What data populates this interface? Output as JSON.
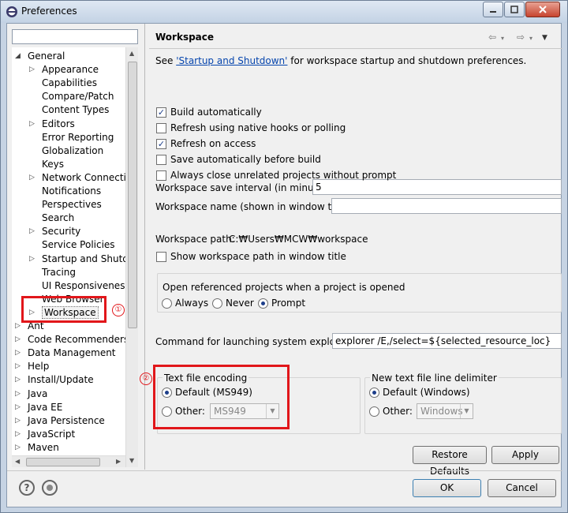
{
  "window": {
    "title": "Preferences"
  },
  "filter": {
    "value": ""
  },
  "tree": {
    "items": [
      {
        "label": "General",
        "level": 0,
        "expander": "open"
      },
      {
        "label": "Appearance",
        "level": 1,
        "expander": "closed"
      },
      {
        "label": "Capabilities",
        "level": 1,
        "expander": ""
      },
      {
        "label": "Compare/Patch",
        "level": 1,
        "expander": ""
      },
      {
        "label": "Content Types",
        "level": 1,
        "expander": ""
      },
      {
        "label": "Editors",
        "level": 1,
        "expander": "closed"
      },
      {
        "label": "Error Reporting",
        "level": 1,
        "expander": ""
      },
      {
        "label": "Globalization",
        "level": 1,
        "expander": ""
      },
      {
        "label": "Keys",
        "level": 1,
        "expander": ""
      },
      {
        "label": "Network Connection",
        "level": 1,
        "expander": "closed"
      },
      {
        "label": "Notifications",
        "level": 1,
        "expander": ""
      },
      {
        "label": "Perspectives",
        "level": 1,
        "expander": ""
      },
      {
        "label": "Search",
        "level": 1,
        "expander": ""
      },
      {
        "label": "Security",
        "level": 1,
        "expander": "closed"
      },
      {
        "label": "Service Policies",
        "level": 1,
        "expander": ""
      },
      {
        "label": "Startup and Shutdown",
        "level": 1,
        "expander": "closed"
      },
      {
        "label": "Tracing",
        "level": 1,
        "expander": ""
      },
      {
        "label": "UI Responsiveness M",
        "level": 1,
        "expander": ""
      },
      {
        "label": "Web Browser",
        "level": 1,
        "expander": ""
      },
      {
        "label": "Workspace",
        "level": 1,
        "expander": "closed"
      },
      {
        "label": "Ant",
        "level": 0,
        "expander": "closed"
      },
      {
        "label": "Code Recommenders",
        "level": 0,
        "expander": "closed"
      },
      {
        "label": "Data Management",
        "level": 0,
        "expander": "closed"
      },
      {
        "label": "Help",
        "level": 0,
        "expander": "closed"
      },
      {
        "label": "Install/Update",
        "level": 0,
        "expander": "closed"
      },
      {
        "label": "Java",
        "level": 0,
        "expander": "closed"
      },
      {
        "label": "Java EE",
        "level": 0,
        "expander": "closed"
      },
      {
        "label": "Java Persistence",
        "level": 0,
        "expander": "closed"
      },
      {
        "label": "JavaScript",
        "level": 0,
        "expander": "closed"
      },
      {
        "label": "Maven",
        "level": 0,
        "expander": "closed"
      }
    ]
  },
  "page": {
    "title": "Workspace",
    "see_prefix": "See ",
    "see_link": "'Startup and Shutdown'",
    "see_suffix": " for workspace startup and shutdown preferences.",
    "checkboxes": [
      {
        "label": "Build automatically",
        "checked": true
      },
      {
        "label": "Refresh using native hooks or polling",
        "checked": false
      },
      {
        "label": "Refresh on access",
        "checked": true
      },
      {
        "label": "Save automatically before build",
        "checked": false
      },
      {
        "label": "Always close unrelated projects without prompt",
        "checked": false
      }
    ],
    "save_interval_label": "Workspace save interval (in minutes):",
    "save_interval_value": "5",
    "workspace_name_label": "Workspace name (shown in window title):",
    "workspace_name_value": "",
    "workspace_path_label": "Workspace path:",
    "workspace_path_value": "C:₩Users₩MCW₩workspace",
    "show_path_label": "Show workspace path in window title",
    "open_ref_label": "Open referenced projects when a project is opened",
    "open_ref_options": [
      "Always",
      "Never",
      "Prompt"
    ],
    "open_ref_selected": "Prompt",
    "command_label": "Command for launching system explorer:",
    "command_value": "explorer /E,/select=${selected_resource_loc}",
    "encoding_group": {
      "title": "Text file encoding",
      "default_label": "Default (MS949)",
      "other_label": "Other:",
      "other_value": "MS949"
    },
    "delimiter_group": {
      "title": "New text file line delimiter",
      "default_label": "Default (Windows)",
      "other_label": "Other:",
      "other_value": "Windows"
    },
    "restore_defaults": "Restore Defaults",
    "apply": "Apply"
  },
  "footer": {
    "ok": "OK",
    "cancel": "Cancel"
  },
  "annotations": {
    "badge1": "①",
    "badge2": "②"
  },
  "colors": {
    "annotation": "#e1161a",
    "link": "#0645ad"
  }
}
